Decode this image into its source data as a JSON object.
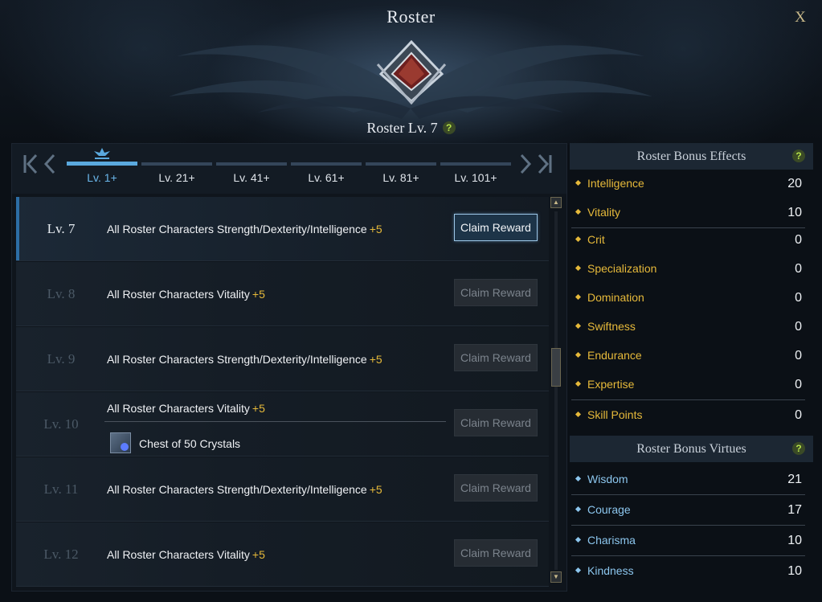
{
  "window": {
    "title": "Roster",
    "close_label": "X"
  },
  "header": {
    "roster_level": "Roster Lv. 7",
    "help": "?"
  },
  "tabs": {
    "nav_first": "K",
    "nav_prev": "‹",
    "nav_next": "›",
    "nav_last": "K",
    "items": [
      {
        "label": "Lv. 1+",
        "active": true
      },
      {
        "label": "Lv. 21+",
        "active": false
      },
      {
        "label": "Lv. 41+",
        "active": false
      },
      {
        "label": "Lv. 61+",
        "active": false
      },
      {
        "label": "Lv. 81+",
        "active": false
      },
      {
        "label": "Lv. 101+",
        "active": false
      }
    ]
  },
  "rewards": [
    {
      "level": "Lv. 7",
      "text": "All Roster Characters Strength/Dexterity/Intelligence",
      "bonus": "+5",
      "button": "Claim Reward",
      "claimable": true
    },
    {
      "level": "Lv. 8",
      "text": "All Roster Characters Vitality",
      "bonus": "+5",
      "button": "Claim Reward",
      "claimable": false
    },
    {
      "level": "Lv. 9",
      "text": "All Roster Characters Strength/Dexterity/Intelligence",
      "bonus": "+5",
      "button": "Claim Reward",
      "claimable": false
    },
    {
      "level": "Lv. 10",
      "text": "All Roster Characters Vitality",
      "bonus": "+5",
      "item": "Chest of 50 Crystals",
      "button": "Claim Reward",
      "claimable": false
    },
    {
      "level": "Lv. 11",
      "text": "All Roster Characters Strength/Dexterity/Intelligence",
      "bonus": "+5",
      "button": "Claim Reward",
      "claimable": false
    },
    {
      "level": "Lv. 12",
      "text": "All Roster Characters Vitality",
      "bonus": "+5",
      "button": "Claim Reward",
      "claimable": false
    }
  ],
  "scroll": {
    "up": "▲",
    "down": "▼"
  },
  "bonus_effects": {
    "title": "Roster Bonus Effects",
    "help": "?",
    "items": [
      {
        "name": "Intelligence",
        "value": "20"
      },
      {
        "name": "Vitality",
        "value": "10"
      },
      {
        "name": "Crit",
        "value": "0"
      },
      {
        "name": "Specialization",
        "value": "0"
      },
      {
        "name": "Domination",
        "value": "0"
      },
      {
        "name": "Swiftness",
        "value": "0"
      },
      {
        "name": "Endurance",
        "value": "0"
      },
      {
        "name": "Expertise",
        "value": "0"
      },
      {
        "name": "Skill Points",
        "value": "0"
      }
    ]
  },
  "bonus_virtues": {
    "title": "Roster Bonus Virtues",
    "help": "?",
    "items": [
      {
        "name": "Wisdom",
        "value": "21"
      },
      {
        "name": "Courage",
        "value": "17"
      },
      {
        "name": "Charisma",
        "value": "10"
      },
      {
        "name": "Kindness",
        "value": "10"
      }
    ]
  },
  "colors": {
    "effect_text": "#e6b93a",
    "virtue_text": "#8cc6ee",
    "active_tab": "#5aa9de",
    "bonus": "#e6b93a"
  }
}
